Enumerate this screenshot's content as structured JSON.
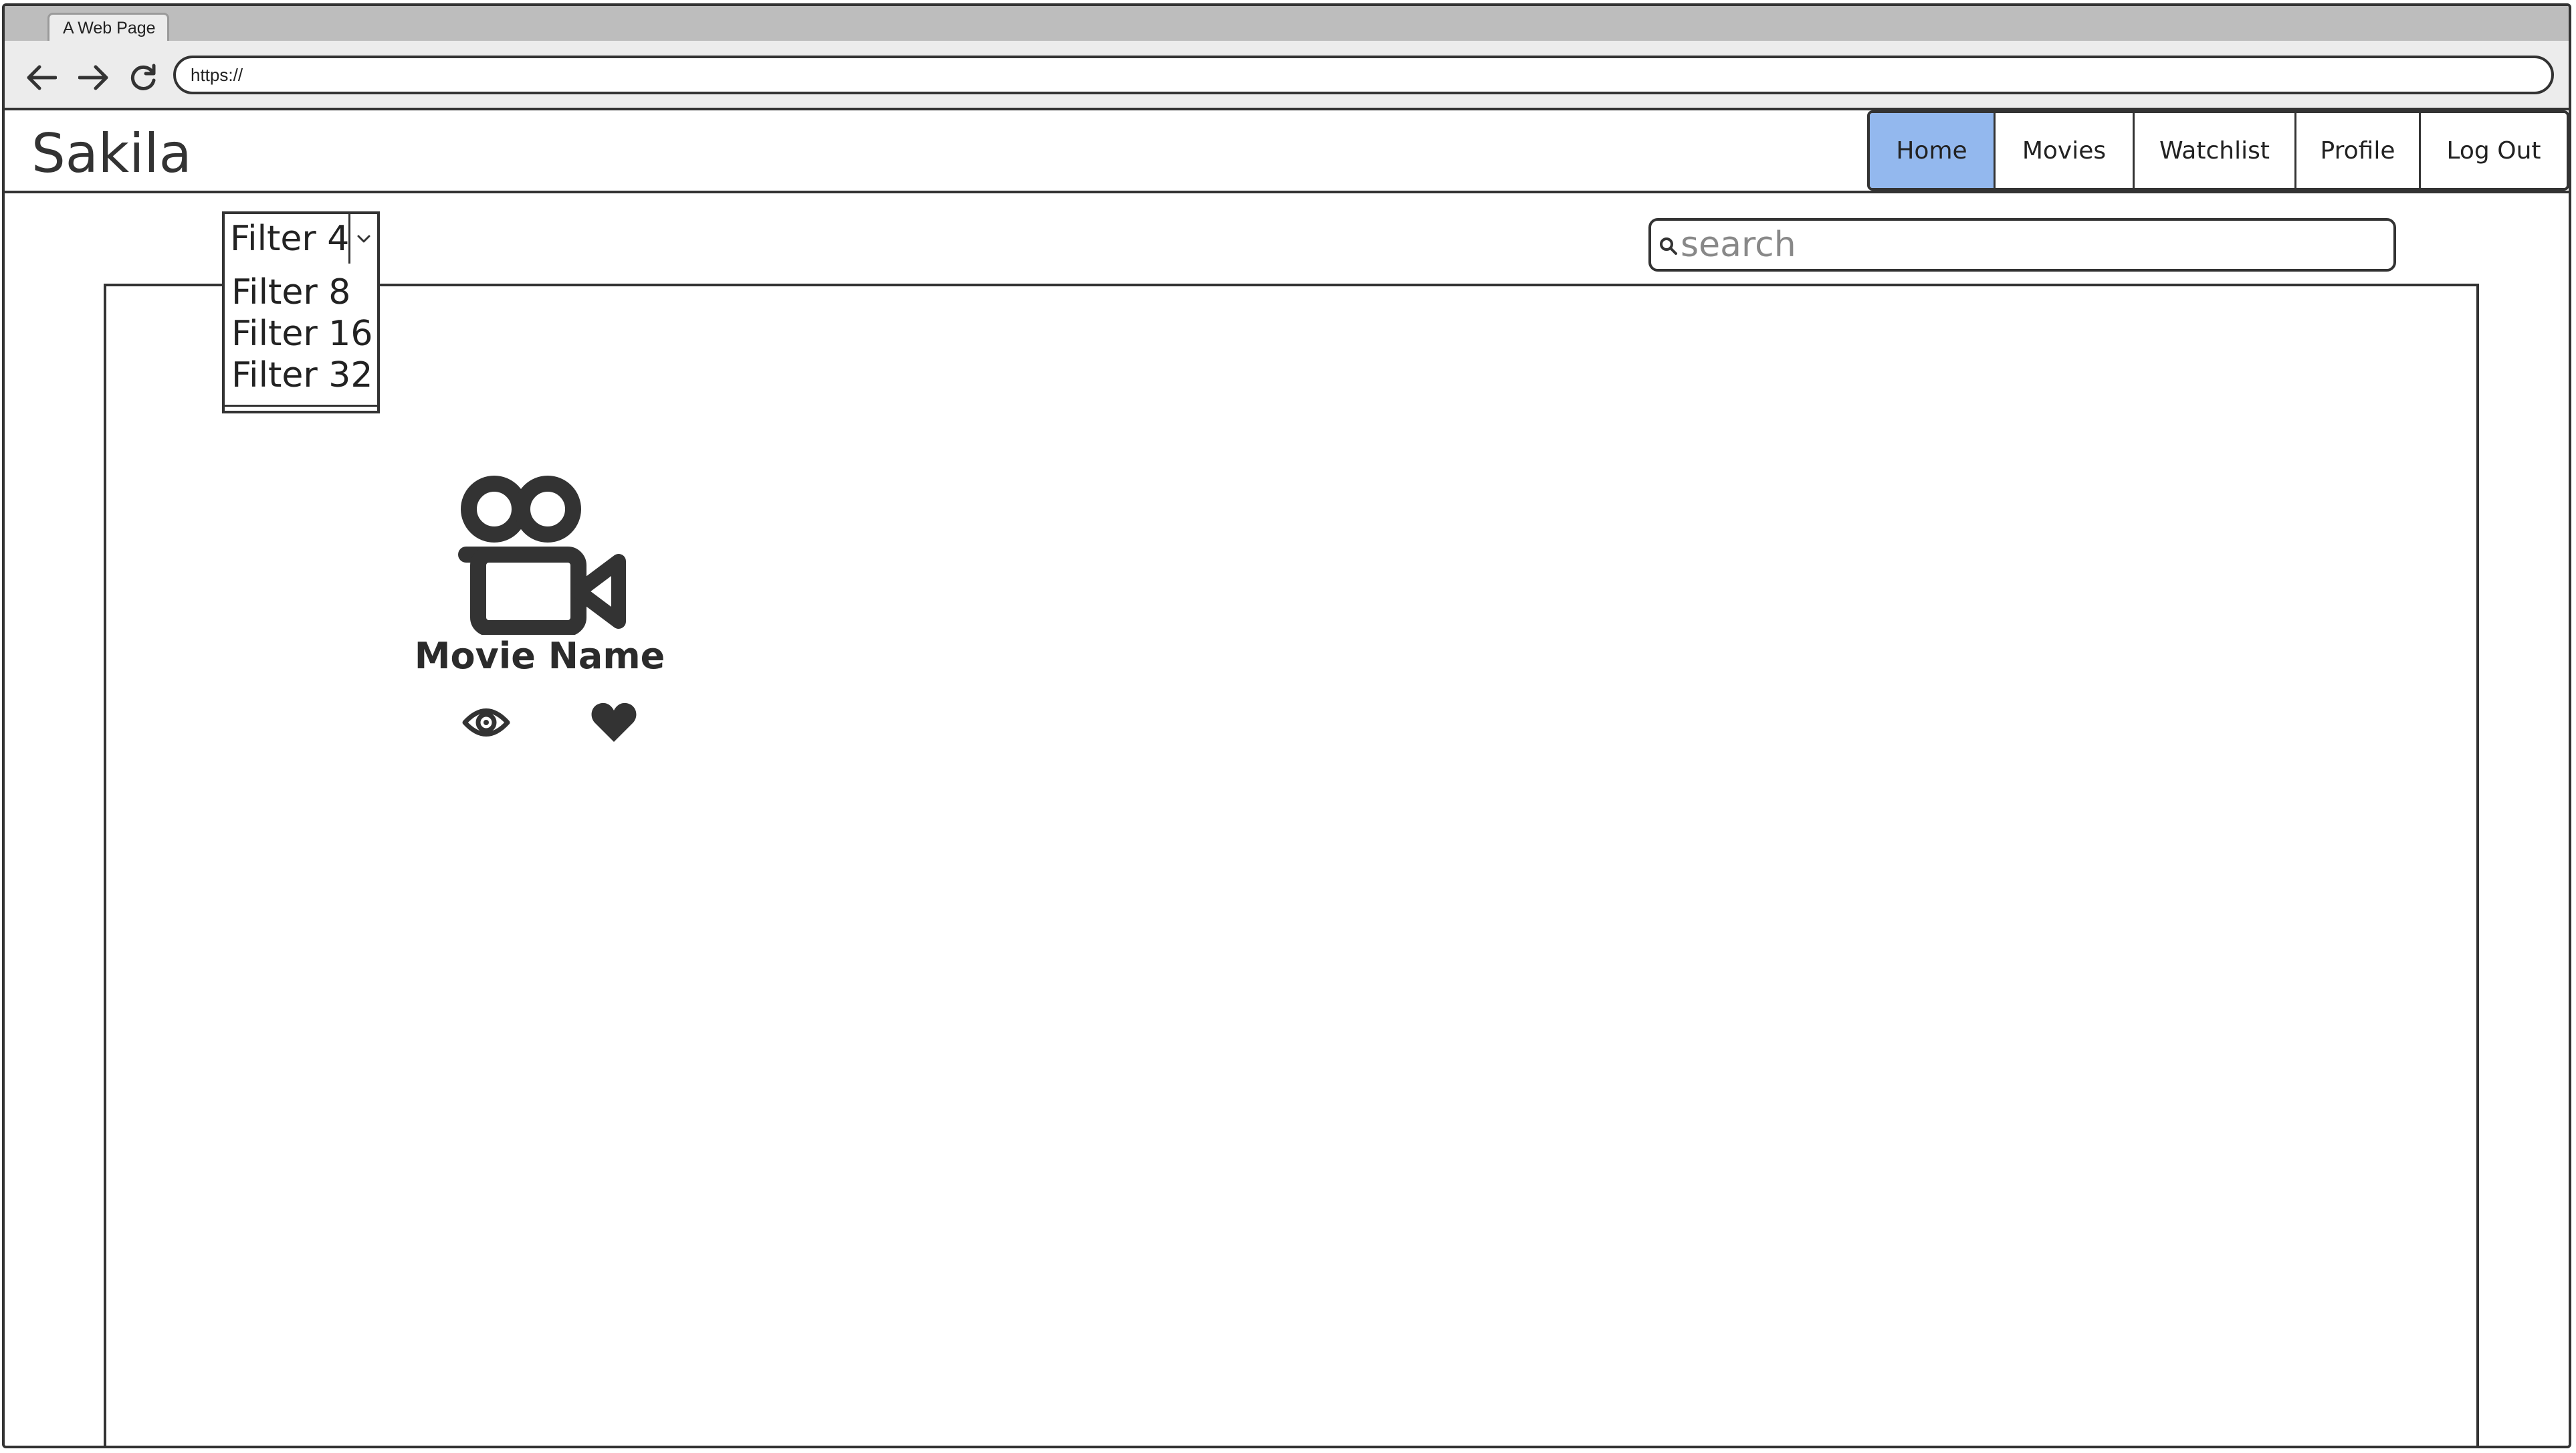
{
  "browser": {
    "tab_title": "A Web Page",
    "url": "https://",
    "icons": [
      "back-arrow-icon",
      "forward-arrow-icon",
      "reload-icon"
    ]
  },
  "header": {
    "brand": "Sakila",
    "nav": [
      {
        "label": "Home",
        "active": true
      },
      {
        "label": "Movies",
        "active": false
      },
      {
        "label": "Watchlist",
        "active": false
      },
      {
        "label": "Profile",
        "active": false
      },
      {
        "label": "Log Out",
        "active": false
      }
    ],
    "active_color": "#93b8ee"
  },
  "filter": {
    "selected": "Filter 4",
    "options": [
      "Filter 8",
      "Filter 16",
      "Filter 32"
    ]
  },
  "search": {
    "placeholder": "search"
  },
  "movies": [
    {
      "name": "Movie Name",
      "icon": "movie-camera-icon",
      "actions": [
        "eye-icon",
        "heart-icon"
      ]
    }
  ]
}
